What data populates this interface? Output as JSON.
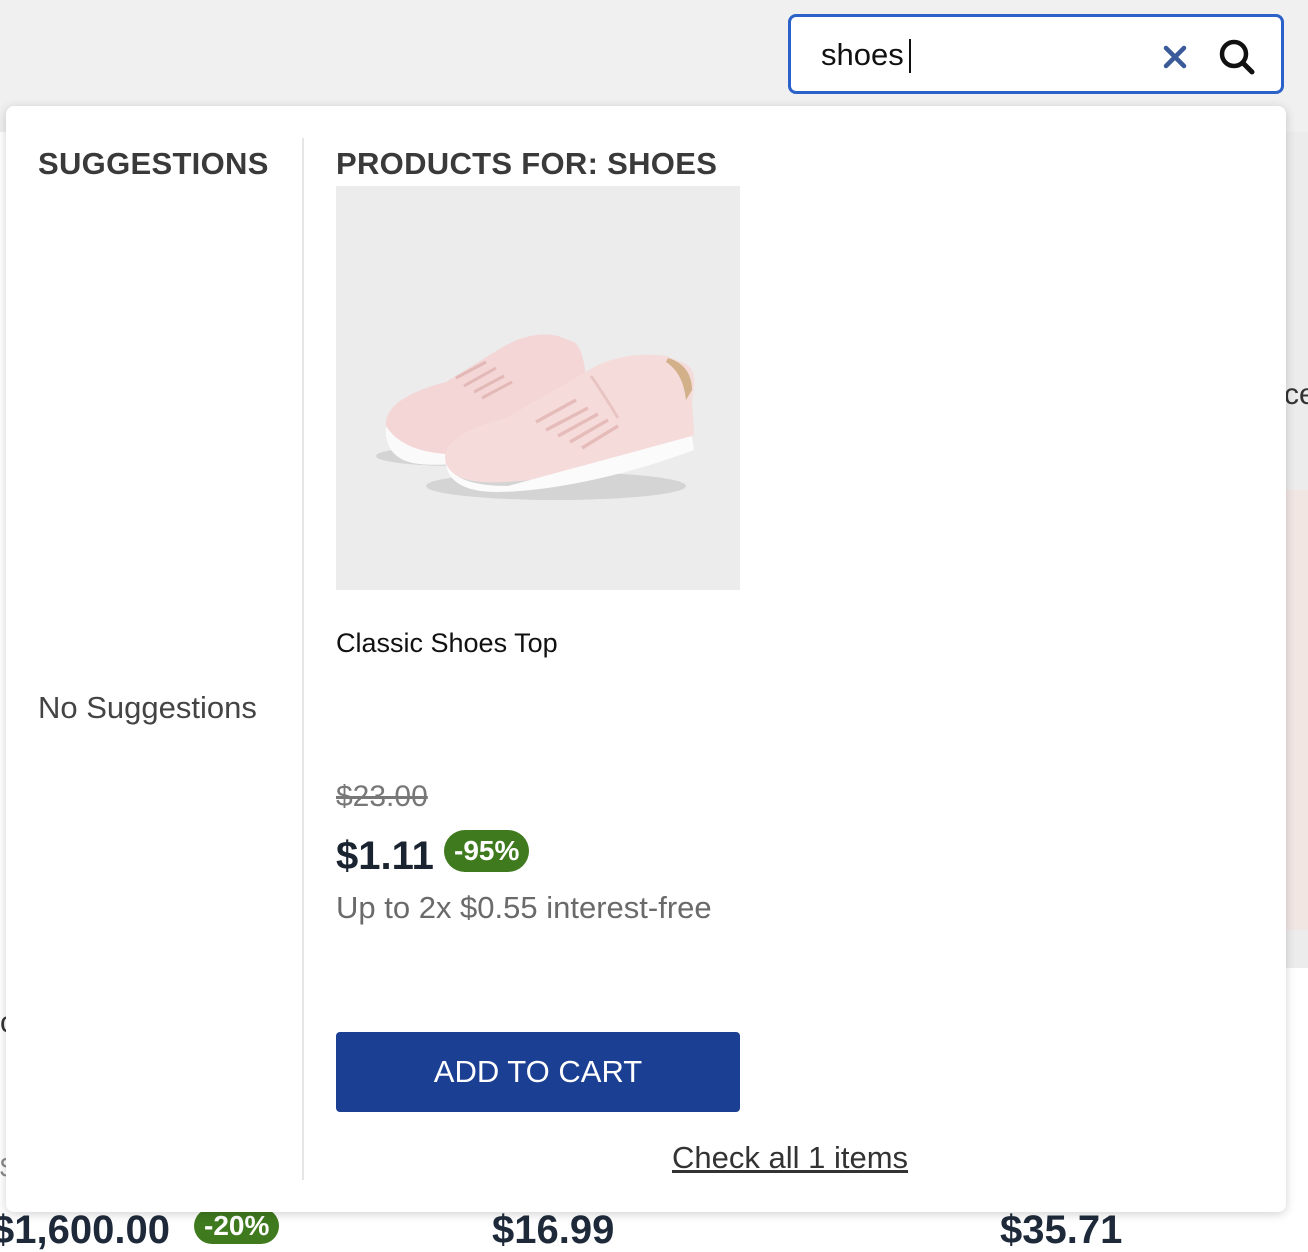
{
  "search": {
    "value": "shoes",
    "icons": {
      "clear": "close-icon",
      "submit": "search-icon"
    },
    "border_color": "#2b62c9"
  },
  "suggestions": {
    "heading": "SUGGESTIONS",
    "empty_text": "No Suggestions"
  },
  "products": {
    "heading": "PRODUCTS FOR: SHOES",
    "items": [
      {
        "name": "Classic Shoes Top",
        "image": "pink-sneakers-image",
        "original_price": "$23.00",
        "price": "$1.11",
        "discount": "-95%",
        "installments": "Up to 2x $0.55 interest-free",
        "button_label": "ADD TO CART"
      }
    ],
    "check_all": "Check all 1 items"
  },
  "background": {
    "fragments": [
      "ce",
      "c",
      "$"
    ],
    "prices": [
      "$1,600.00",
      "$16.99",
      "$35.71"
    ],
    "badge": "-20%"
  },
  "colors": {
    "accent_button": "#1b3f93",
    "discount_badge": "#3f7a1e"
  }
}
